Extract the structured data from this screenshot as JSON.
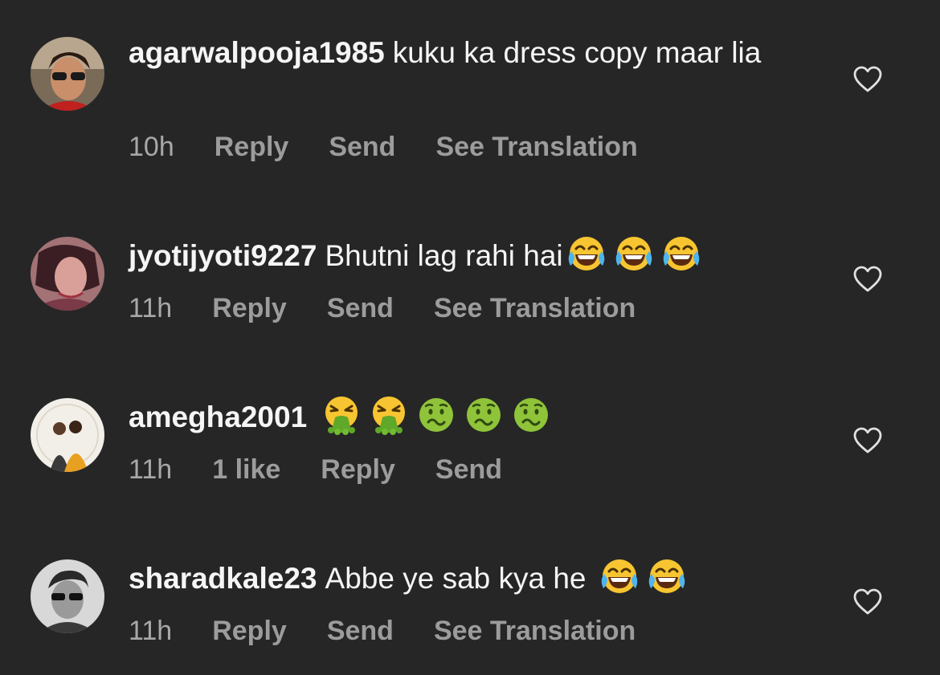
{
  "comments": [
    {
      "username": "agarwalpooja1985",
      "text": "kuku ka dress copy maar lia",
      "time": "10h",
      "like_count": "",
      "reply": "Reply",
      "send": "Send",
      "translate": "See Translation"
    },
    {
      "username": "jyotijyoti9227",
      "text": "Bhutni lag rahi hai",
      "emojis": [
        "face-with-tears-of-joy",
        "face-with-tears-of-joy",
        "face-with-tears-of-joy"
      ],
      "time": "11h",
      "reply": "Reply",
      "send": "Send",
      "translate": "See Translation"
    },
    {
      "username": "amegha2001",
      "text": "",
      "emojis": [
        "face-vomiting",
        "face-vomiting",
        "nauseated-face",
        "nauseated-face",
        "nauseated-face"
      ],
      "time": "11h",
      "likes": "1 like",
      "reply": "Reply",
      "send": "Send"
    },
    {
      "username": "sharadkale23",
      "text": "Abbe ye sab kya he",
      "emojis": [
        "face-with-tears-of-joy",
        "face-with-tears-of-joy"
      ],
      "time": "11h",
      "reply": "Reply",
      "send": "Send",
      "translate": "See Translation"
    }
  ],
  "icons": {
    "like": "heart-outline-icon"
  },
  "colors": {
    "background": "#262626",
    "text": "#f5f5f5",
    "meta": "#9c9c9c"
  }
}
